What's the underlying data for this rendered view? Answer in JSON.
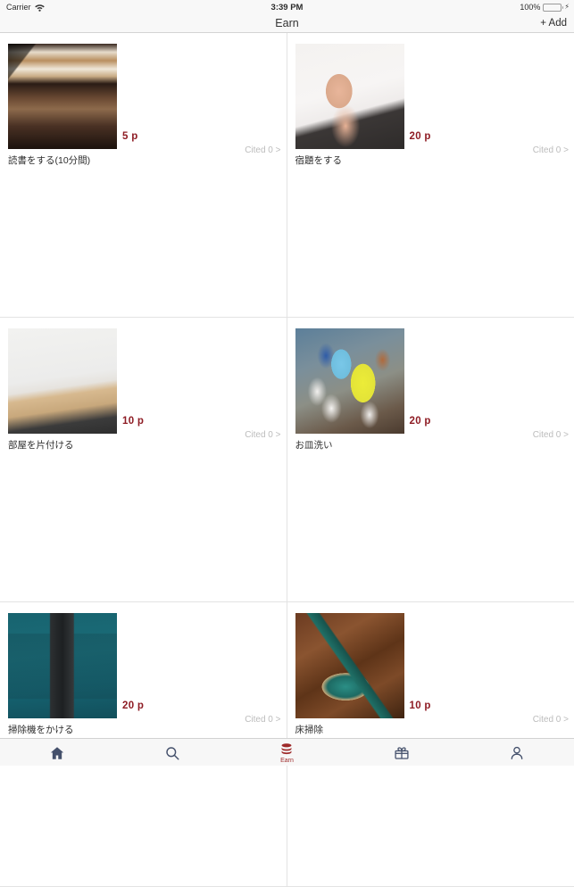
{
  "status_bar": {
    "carrier": "Carrier",
    "wifi_icon": "wifi-icon",
    "time": "3:39 PM",
    "battery_percent": "100%",
    "battery_icon": "battery-full-icon",
    "charging_icon": "lightning-bolt-icon"
  },
  "nav_bar": {
    "title": "Earn",
    "add_label": "+ Add",
    "add_icon": "plus-icon"
  },
  "colors": {
    "points": "#8e1c24",
    "tab_active": "#9e2a2a",
    "tab_inactive": "#44506b",
    "battery": "#4cd264",
    "divider": "#e3e3e3",
    "cited_text": "#bcbcbc"
  },
  "tasks": [
    {
      "caption": "読書をする(10分間)",
      "points": "5 p",
      "cited": "Cited 0 >",
      "image_name": "reading-book-photo"
    },
    {
      "caption": "宿題をする",
      "points": "20 p",
      "cited": "Cited 0 >",
      "image_name": "homework-notebook-photo"
    },
    {
      "caption": "部屋を片付ける",
      "points": "10 p",
      "cited": "Cited 0 >",
      "image_name": "tidy-room-photo"
    },
    {
      "caption": "お皿洗い",
      "points": "20 p",
      "cited": "Cited 0 >",
      "image_name": "dishes-cups-photo"
    },
    {
      "caption": "掃除機をかける",
      "points": "20 p",
      "cited": "Cited 0 >",
      "image_name": "vacuum-cleaner-photo"
    },
    {
      "caption": "床掃除",
      "points": "10 p",
      "cited": "Cited 0 >",
      "image_name": "floor-mop-photo"
    }
  ],
  "tab_bar": {
    "items": [
      {
        "icon": "home-icon",
        "label": "",
        "active": false
      },
      {
        "icon": "search-icon",
        "label": "",
        "active": false
      },
      {
        "icon": "coins-icon",
        "label": "Earn",
        "active": true
      },
      {
        "icon": "gift-icon",
        "label": "",
        "active": false
      },
      {
        "icon": "person-icon",
        "label": "",
        "active": false
      }
    ]
  }
}
